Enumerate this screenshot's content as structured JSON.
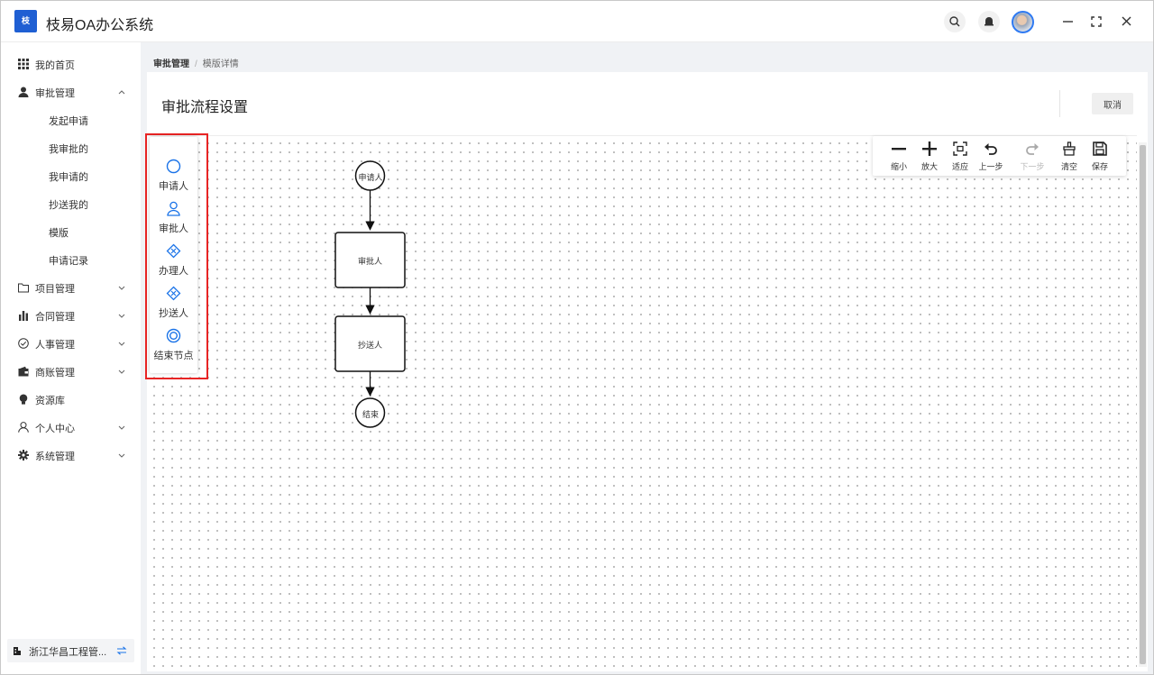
{
  "app": {
    "title": "枝易OA办公系统",
    "logo_text": "枝"
  },
  "sidebar": {
    "items": [
      {
        "label": "我的首页",
        "icon": "grid-icon"
      },
      {
        "label": "审批管理",
        "icon": "user-icon",
        "expanded": true,
        "children": [
          "发起申请",
          "我审批的",
          "我申请的",
          "抄送我的",
          "模版",
          "申请记录"
        ]
      },
      {
        "label": "项目管理",
        "icon": "folder-icon"
      },
      {
        "label": "合同管理",
        "icon": "bar-chart-icon"
      },
      {
        "label": "人事管理",
        "icon": "check-circle-icon"
      },
      {
        "label": "商账管理",
        "icon": "wallet-icon"
      },
      {
        "label": "资源库",
        "icon": "bulb-icon"
      },
      {
        "label": "个人中心",
        "icon": "person-icon"
      },
      {
        "label": "系统管理",
        "icon": "gear-icon"
      }
    ],
    "company": "浙江华昌工程管..."
  },
  "breadcrumb": {
    "parent": "审批管理",
    "separator": "/",
    "current": "模版详情"
  },
  "page": {
    "title": "审批流程设置",
    "cancel_label": "取消"
  },
  "palette": [
    {
      "label": "申请人",
      "icon": "start-circle-icon"
    },
    {
      "label": "审批人",
      "icon": "approver-person-icon"
    },
    {
      "label": "办理人",
      "icon": "handler-diamond-icon"
    },
    {
      "label": "抄送人",
      "icon": "cc-diamond-icon"
    },
    {
      "label": "结束节点",
      "icon": "end-circle-icon"
    }
  ],
  "toolbar": [
    {
      "label": "缩小",
      "icon": "minus-icon",
      "enabled": true
    },
    {
      "label": "放大",
      "icon": "plus-icon",
      "enabled": true
    },
    {
      "label": "适应",
      "icon": "fit-icon",
      "enabled": true
    },
    {
      "label": "上一步",
      "icon": "undo-icon",
      "enabled": true
    },
    {
      "label": "下一步",
      "icon": "redo-icon",
      "enabled": false
    },
    {
      "label": "清空",
      "icon": "clear-icon",
      "enabled": true
    },
    {
      "label": "保存",
      "icon": "save-icon",
      "enabled": true
    }
  ],
  "flow": {
    "nodes": [
      {
        "id": "start",
        "type": "circle",
        "label": "申请人"
      },
      {
        "id": "approver",
        "type": "rect",
        "label": "审批人"
      },
      {
        "id": "cc",
        "type": "rect",
        "label": "抄送人"
      },
      {
        "id": "end",
        "type": "circle",
        "label": "结束"
      }
    ]
  },
  "colors": {
    "accent": "#1a73e8",
    "logo_bg": "#1f5fd3",
    "highlight_border": "#e82424"
  }
}
